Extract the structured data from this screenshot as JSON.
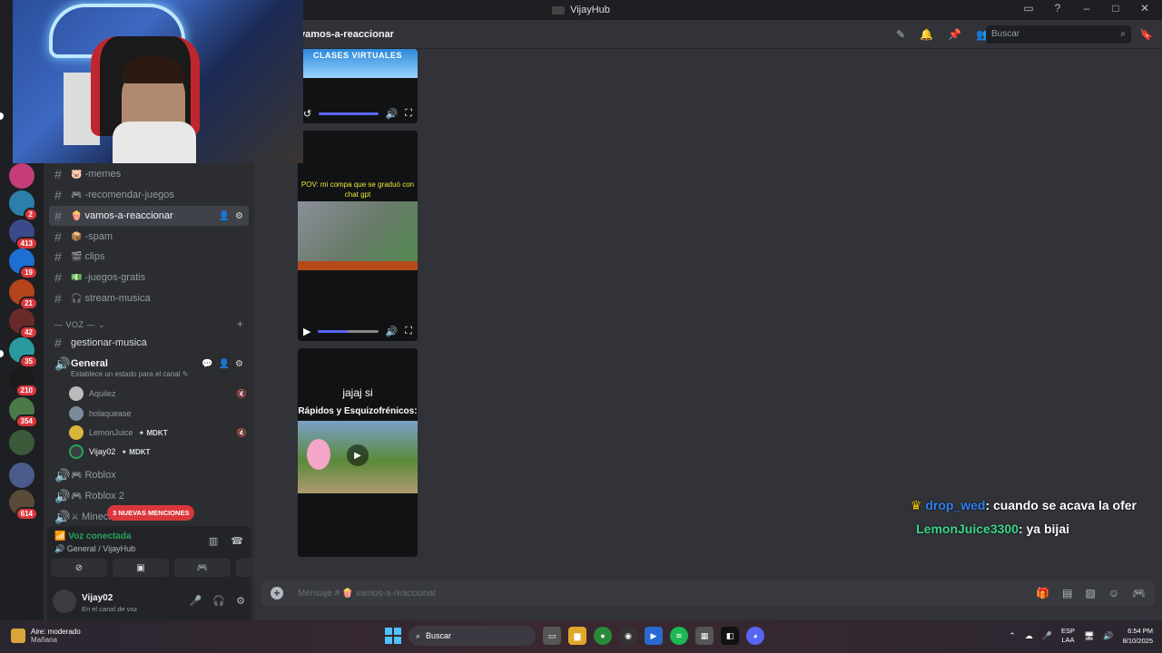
{
  "window": {
    "title": "VijayHub"
  },
  "rail": {
    "badges": [
      "2",
      "413",
      "19",
      "21",
      "42",
      "35",
      "210",
      "354",
      "614"
    ]
  },
  "channels": {
    "items": [
      {
        "name": "-memes",
        "emoji": "🐷"
      },
      {
        "name": "-recomendar-juegos",
        "emoji": "🎮"
      },
      {
        "name": "vamos-a-reaccionar",
        "emoji": "🍿"
      },
      {
        "name": "-spam",
        "emoji": "📦"
      },
      {
        "name": "clips",
        "emoji": "🎬",
        "suffix": ""
      },
      {
        "name": "-juegos-gratis",
        "emoji": "💵"
      },
      {
        "name": "stream-musica",
        "emoji": "🎧"
      }
    ],
    "voice_category": "VOZ",
    "gestionar": "gestionar-musica",
    "voice_general": "General",
    "voice_status": "Establece un estado para el canal",
    "voice_users": [
      {
        "name": "Aquilez",
        "tag": ""
      },
      {
        "name": "holaquease",
        "tag": ""
      },
      {
        "name": "LemonJuice",
        "tag": "MDKT"
      },
      {
        "name": "Vijay02",
        "tag": "MDKT"
      }
    ],
    "roblox": "Roblox",
    "roblox2": "Roblox 2",
    "minecraft": "Minecr",
    "mentions": "3 NUEVAS MENCIONES"
  },
  "voice_panel": {
    "status": "Voz conectada",
    "sub": "General / VijayHub"
  },
  "user_panel": {
    "name": "Vijay02",
    "sub": "En el canal de voz"
  },
  "chat": {
    "channel": "vamos-a-reaccionar",
    "search_placeholder": "Buscar",
    "composer_placeholder": "Mensaje # 🍿 vamos-a-reaccionar",
    "media1_title": "CLASES VIRTUALES",
    "media2_text": "POV: mi compa que se graduó con chat gpt",
    "media3_top": "jajaj si",
    "media3_title": "Rápidos y Esquizofrénicos:"
  },
  "overlay": [
    {
      "user": "drop_wed",
      "message": ": cuando se acava la ofer"
    },
    {
      "user": "LemonJuice3300",
      "message": ": ya bijai"
    }
  ],
  "taskbar": {
    "weather": "Aire: moderado",
    "weather_sub": "Mañana",
    "search": "Buscar",
    "lang1": "ESP",
    "lang2": "LAA",
    "time": "6:54 PM",
    "date": "8/10/2025"
  },
  "colors": {
    "accent": "#5865f2",
    "danger": "#da373c",
    "online": "#23a55a"
  }
}
